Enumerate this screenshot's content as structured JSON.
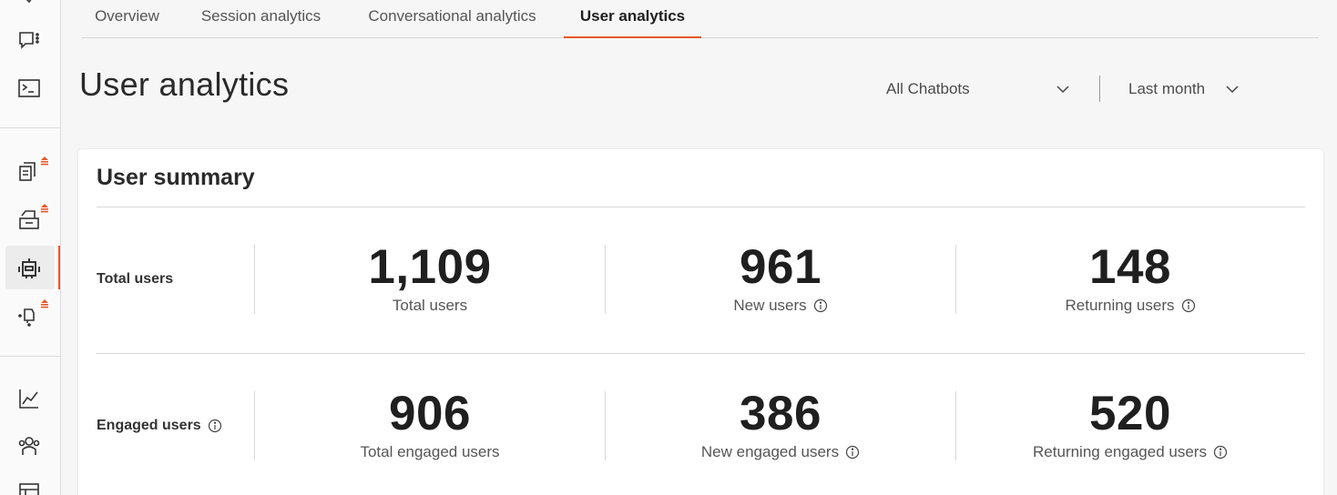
{
  "tabs": [
    {
      "label": "Overview"
    },
    {
      "label": "Session analytics"
    },
    {
      "label": "Conversational analytics"
    },
    {
      "label": "User analytics"
    }
  ],
  "page": {
    "title": "User analytics",
    "chatbot_filter": "All Chatbots",
    "period_filter": "Last month"
  },
  "summary": {
    "title": "User summary",
    "total_row": {
      "label": "Total users",
      "metrics": [
        {
          "value": "1,109",
          "caption": "Total users"
        },
        {
          "value": "961",
          "caption": "New users"
        },
        {
          "value": "148",
          "caption": "Returning users"
        }
      ]
    },
    "engaged_row": {
      "label": "Engaged users",
      "metrics": [
        {
          "value": "906",
          "caption": "Total engaged users"
        },
        {
          "value": "386",
          "caption": "New engaged users"
        },
        {
          "value": "520",
          "caption": "Returning engaged users"
        }
      ]
    }
  },
  "rail_icons": [
    "check-icon",
    "chat-icon",
    "terminal-icon",
    "knowledge-upgrade-icon",
    "inbox-upgrade-icon",
    "bot-icon",
    "action-upgrade-icon",
    "analytics-icon",
    "users-icon",
    "layout-icon"
  ],
  "colors": {
    "accent": "#e8572a"
  }
}
